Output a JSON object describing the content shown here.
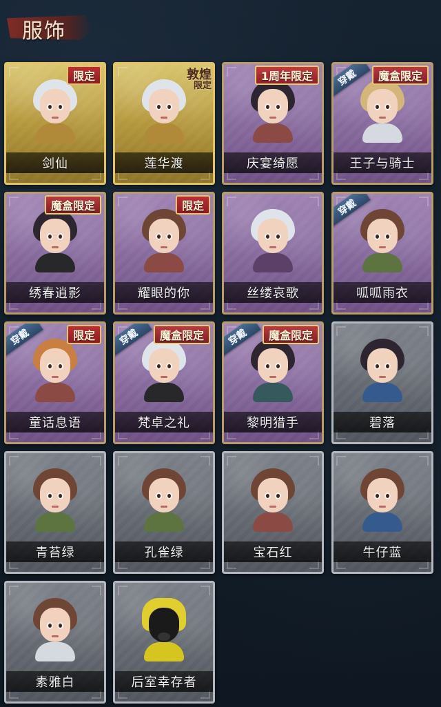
{
  "header": {
    "title": "服饰"
  },
  "costumes": [
    {
      "name": "剑仙",
      "badge": "限定",
      "equip": "",
      "variant": "gold",
      "portrait": "white-hair",
      "outfit": "gold"
    },
    {
      "name": "莲华渡",
      "badge": "敦煌限定",
      "equip": "",
      "variant": "gold",
      "portrait": "white-hair",
      "outfit": "gold"
    },
    {
      "name": "庆宴绮愿",
      "badge": "1周年限定",
      "equip": "",
      "variant": "purple",
      "portrait": "dark",
      "outfit": "red"
    },
    {
      "name": "王子与骑士",
      "badge": "魔盒限定",
      "equip": "穿戴",
      "variant": "purple",
      "portrait": "blonde",
      "outfit": "white"
    },
    {
      "name": "绣春逍影",
      "badge": "魔盒限定",
      "equip": "",
      "variant": "purple",
      "portrait": "dark",
      "outfit": "dark"
    },
    {
      "name": "耀眼的你",
      "badge": "限定",
      "equip": "",
      "variant": "purple",
      "portrait": "brown",
      "outfit": "red"
    },
    {
      "name": "丝缕哀歌",
      "badge": "",
      "equip": "",
      "variant": "purple",
      "portrait": "white-hair",
      "outfit": "purple"
    },
    {
      "name": "呱呱雨衣",
      "badge": "",
      "equip": "穿戴",
      "variant": "purple",
      "portrait": "brown",
      "outfit": "green"
    },
    {
      "name": "童话息语",
      "badge": "限定",
      "equip": "穿戴",
      "variant": "purple",
      "portrait": "red",
      "outfit": "red"
    },
    {
      "name": "梵卓之礼",
      "badge": "魔盒限定",
      "equip": "穿戴",
      "variant": "purple",
      "portrait": "white-hair",
      "outfit": "dark"
    },
    {
      "name": "黎明猎手",
      "badge": "魔盒限定",
      "equip": "穿戴",
      "variant": "purple",
      "portrait": "dark",
      "outfit": "teal"
    },
    {
      "name": "碧落",
      "badge": "",
      "equip": "",
      "variant": "gray",
      "portrait": "dark",
      "outfit": "blue"
    },
    {
      "name": "青苔绿",
      "badge": "",
      "equip": "",
      "variant": "gray",
      "portrait": "brown",
      "outfit": "green"
    },
    {
      "name": "孔雀绿",
      "badge": "",
      "equip": "",
      "variant": "gray",
      "portrait": "brown",
      "outfit": "green"
    },
    {
      "name": "宝石红",
      "badge": "",
      "equip": "",
      "variant": "gray",
      "portrait": "brown",
      "outfit": "red"
    },
    {
      "name": "牛仔蓝",
      "badge": "",
      "equip": "",
      "variant": "gray",
      "portrait": "brown",
      "outfit": "blue"
    },
    {
      "name": "素雅白",
      "badge": "",
      "equip": "",
      "variant": "gray",
      "portrait": "brown",
      "outfit": "white"
    },
    {
      "name": "后室幸存者",
      "badge": "",
      "equip": "",
      "variant": "gray",
      "portrait": "mask",
      "outfit": "yellow"
    }
  ]
}
